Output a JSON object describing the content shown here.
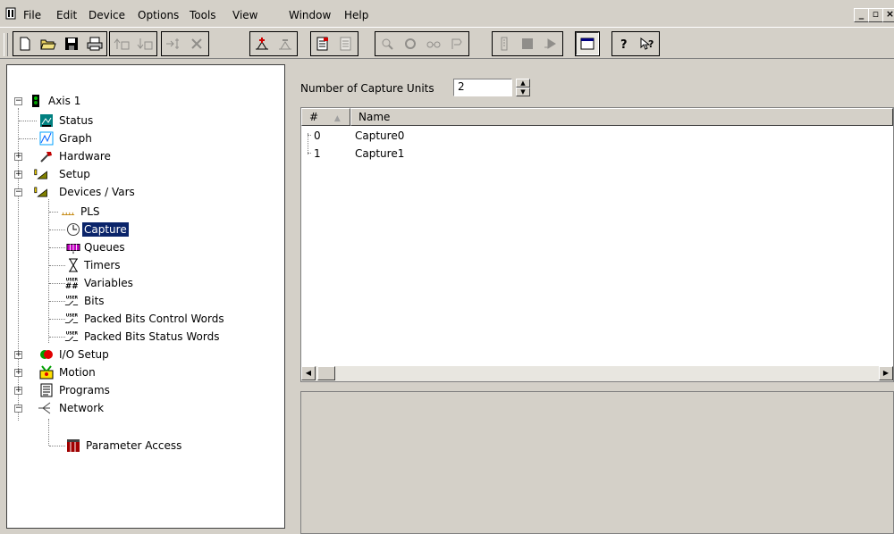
{
  "menu": [
    {
      "label": "File"
    },
    {
      "label": "Edit"
    },
    {
      "label": "Device"
    },
    {
      "label": "Options"
    },
    {
      "label": "Tools"
    },
    {
      "label": "View"
    },
    {
      "label": "Window"
    },
    {
      "label": "Help"
    }
  ],
  "window_controls": {
    "minimize": "_",
    "restore": "▫",
    "close": "×"
  },
  "toolbar_icons": [
    "new-document-icon",
    "open-folder-icon",
    "save-icon",
    "print-icon",
    "upload-icon",
    "download-icon",
    "insert-icon",
    "delete-icon",
    "add-icon",
    "remove-icon",
    "page-icon",
    "page-properties-icon",
    "zoom-icon",
    "refresh-icon",
    "glasses-icon",
    "probe-icon",
    "record-icon",
    "stop-icon",
    "play-icon",
    "window-icon",
    "help-icon",
    "context-help-icon"
  ],
  "tree": {
    "root": "Axis 1",
    "items": [
      {
        "label": "Status"
      },
      {
        "label": "Graph"
      },
      {
        "label": "Hardware"
      },
      {
        "label": "Setup"
      },
      {
        "label": "Devices / Vars"
      },
      {
        "label": "PLS"
      },
      {
        "label": "Capture"
      },
      {
        "label": "Queues"
      },
      {
        "label": "Timers"
      },
      {
        "label": "Variables"
      },
      {
        "label": "Bits"
      },
      {
        "label": "Packed Bits Control Words"
      },
      {
        "label": "Packed Bits Status Words"
      },
      {
        "label": "I/O Setup"
      },
      {
        "label": "Motion"
      },
      {
        "label": "Programs"
      },
      {
        "label": "Network"
      },
      {
        "label": "Parameter Access"
      }
    ],
    "selected": "Capture"
  },
  "capture": {
    "label": "Number of Capture Units",
    "value": "2"
  },
  "list": {
    "columns": [
      "#",
      "Name"
    ],
    "rows": [
      {
        "index": "0",
        "name": "Capture0"
      },
      {
        "index": "1",
        "name": "Capture1"
      }
    ]
  },
  "colors": {
    "selection": "#0a246a",
    "face": "#d4d0c8"
  }
}
